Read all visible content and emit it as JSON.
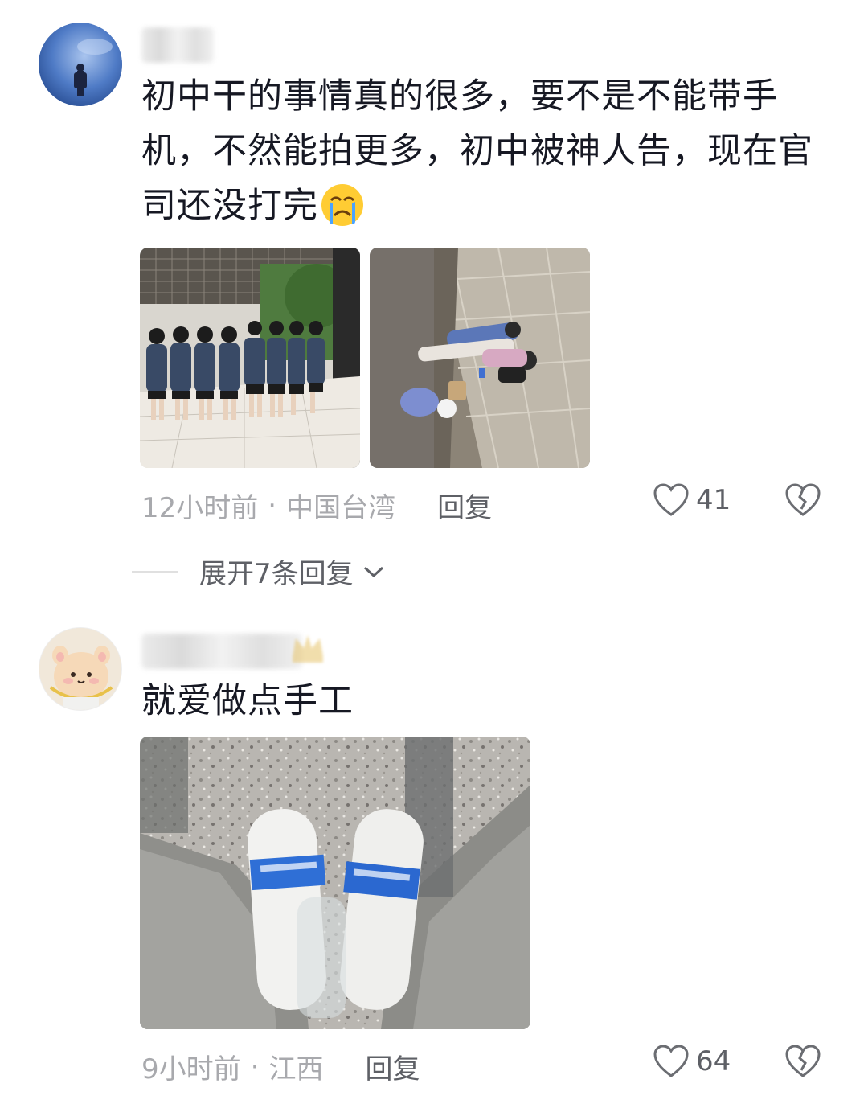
{
  "comments": [
    {
      "text": "初中干的事情真的很多，要不是不能带手机，不然能拍更多，初中被神人告，现在官司还没打完",
      "emoji": "crying-face-icon",
      "time": "12小时前",
      "location": "中国台湾",
      "reply_label": "回复",
      "likes": "41",
      "expand_label": "展开7条回复"
    },
    {
      "text": "就爱做点手工",
      "time": "9小时前",
      "location": "江西",
      "reply_label": "回复",
      "likes": "64"
    }
  ],
  "colors": {
    "text": "#161823",
    "meta": "#a8a9ad",
    "action": "#5e6066"
  },
  "icons": [
    "heart-outline-icon",
    "broken-heart-icon",
    "chevron-down-icon"
  ]
}
